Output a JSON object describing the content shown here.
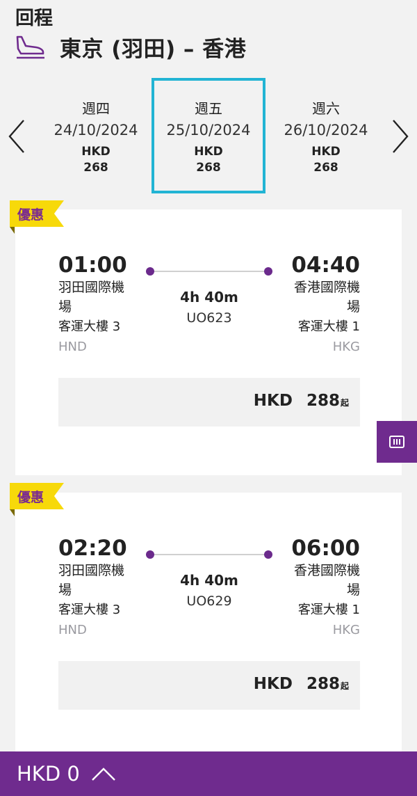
{
  "header": {
    "section_title": "回程",
    "route": "東京 (羽田) – 香港",
    "icon": "plane-landing-icon"
  },
  "date_tabs": [
    {
      "weekday": "週四",
      "date": "24/10/2024",
      "currency": "HKD",
      "price": "268",
      "selected": false
    },
    {
      "weekday": "週五",
      "date": "25/10/2024",
      "currency": "HKD",
      "price": "268",
      "selected": true
    },
    {
      "weekday": "週六",
      "date": "26/10/2024",
      "currency": "HKD",
      "price": "268",
      "selected": false
    }
  ],
  "flights": [
    {
      "badge": "優惠",
      "departure": {
        "time": "01:00",
        "airport_line1": "羽田國際機",
        "airport_line2": "場",
        "terminal": "客運大樓 3",
        "code": "HND"
      },
      "arrival": {
        "time": "04:40",
        "airport_line1": "香港國際機",
        "airport_line2": "場",
        "terminal": "客運大樓 1",
        "code": "HKG"
      },
      "duration": "4h 40m",
      "flight_number": "UO623",
      "price": {
        "currency": "HKD",
        "amount": "288",
        "suffix": "起"
      }
    },
    {
      "badge": "優惠",
      "departure": {
        "time": "02:20",
        "airport_line1": "羽田國際機",
        "airport_line2": "場",
        "terminal": "客運大樓 3",
        "code": "HND"
      },
      "arrival": {
        "time": "06:00",
        "airport_line1": "香港國際機",
        "airport_line2": "場",
        "terminal": "客運大樓 1",
        "code": "HKG"
      },
      "duration": "4h 40m",
      "flight_number": "UO629",
      "price": {
        "currency": "HKD",
        "amount": "288",
        "suffix": "起"
      }
    }
  ],
  "side_button": {
    "icon": "list-toggle-icon"
  },
  "bottom_bar": {
    "total": "HKD 0",
    "icon": "chevron-up-icon"
  },
  "colors": {
    "brand_purple": "#6f2b8e",
    "selected_border": "#22b4d4",
    "badge_yellow": "#f7d90a"
  }
}
